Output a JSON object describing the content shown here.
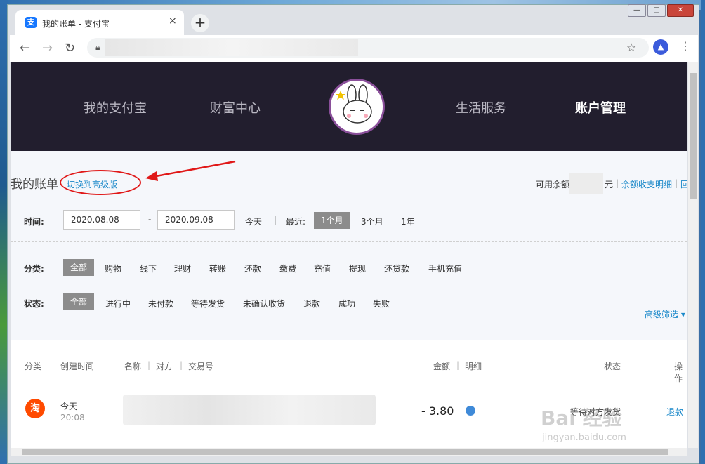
{
  "browser": {
    "tab_title": "我的账单 - 支付宝",
    "tab_icon": "支",
    "new_tab_label": "+",
    "close_tab_label": "×",
    "window_buttons": [
      "—",
      "□",
      "✕"
    ]
  },
  "nav": {
    "items": [
      "我的支付宝",
      "财富中心",
      "生活服务",
      "账户管理"
    ],
    "active": "账户管理"
  },
  "bill": {
    "title": "我的账单",
    "switch_link": "切换到高级版",
    "balance_label": "可用余额",
    "balance_unit": "元",
    "balance_detail_link": "余额收支明细",
    "extra_link": "回"
  },
  "filters": {
    "time_label": "时间:",
    "start_date": "2020.08.08",
    "date_sep": "-",
    "end_date": "2020.09.08",
    "today": "今天",
    "recent_label": "最近:",
    "ranges": [
      "1个月",
      "3个月",
      "1年"
    ],
    "active_range": "1个月",
    "category_label": "分类:",
    "categories": [
      "全部",
      "购物",
      "线下",
      "理财",
      "转账",
      "还款",
      "缴费",
      "充值",
      "提现",
      "还贷款",
      "手机充值"
    ],
    "status_label": "状态:",
    "statuses": [
      "全部",
      "进行中",
      "未付款",
      "等待发货",
      "未确认收货",
      "退款",
      "成功",
      "失败"
    ],
    "advanced_filter": "高级筛选 ▾"
  },
  "table": {
    "headers": {
      "category": "分类",
      "created": "创建时间",
      "name": "名称",
      "counterparty": "对方",
      "trade_no": "交易号",
      "amount": "金额",
      "detail": "明细",
      "status": "状态",
      "ops": "操作"
    },
    "rows": [
      {
        "icon": "淘",
        "date": "今天",
        "time": "20:08",
        "amount": "- 3.80",
        "status": "等待对方发货",
        "action": "退款"
      }
    ]
  },
  "watermark": {
    "main": "Bai 经验",
    "sub": "jingyan.baidu.com"
  },
  "colors": {
    "nav_bg": "#221e2e",
    "link": "#1a88c9",
    "pill": "#8c8c8c",
    "annotation_red": "#e01818",
    "taobao": "#ff4a00"
  }
}
